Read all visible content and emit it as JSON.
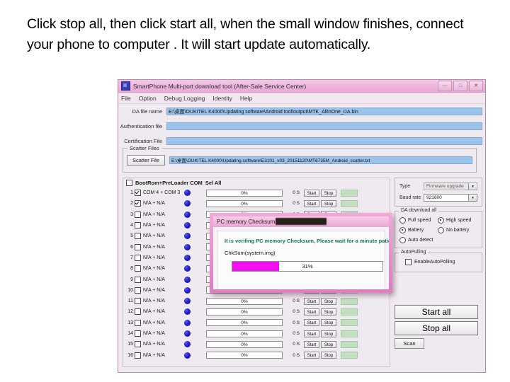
{
  "caption": "Click stop all, then click start all, when the small window finishes, connect your phone to computer . It will start update automatically.",
  "window": {
    "title": "SmartPhone Multi-port download tool (After-Sale Service Center)",
    "icon": "app-icon",
    "controls": {
      "minimize": "—",
      "maximize": "□",
      "close": "✕"
    },
    "menu": [
      "File",
      "Option",
      "Debug Logging",
      "Identity",
      "Help"
    ]
  },
  "files": {
    "da_label": "DA file name",
    "da_value": "E:\\桌面\\OUKITEL K4000\\Updating software\\Android tool\\output\\MTK_AllInOne_DA.bin",
    "auth_label": "Authentication file",
    "auth_value": "",
    "cert_label": "Certification File",
    "cert_value": "",
    "scatter_group": "Scatter Files",
    "scatter_button": "Scatter File",
    "scatter_value": "E:\\桌面\\OUKITEL K4000\\Updating software\\E3101_v03_20151120\\MT6735M_Android_scatter.txt"
  },
  "port_table": {
    "header_checkbox": false,
    "header_label": "BootRom+PreLoader COM",
    "sel_all_label": "Sel All",
    "progress_text": "0%",
    "time_text": "0 S",
    "start_label": "Start",
    "stop_label": "Stop",
    "rows": [
      {
        "num": "1",
        "checked": true,
        "com": "COM 4 + COM 3"
      },
      {
        "num": "2",
        "checked": true,
        "com": "N/A + N/A"
      },
      {
        "num": "3",
        "checked": false,
        "com": "N/A + N/A"
      },
      {
        "num": "4",
        "checked": false,
        "com": "N/A + N/A"
      },
      {
        "num": "5",
        "checked": false,
        "com": "N/A + N/A"
      },
      {
        "num": "6",
        "checked": false,
        "com": "N/A + N/A"
      },
      {
        "num": "7",
        "checked": false,
        "com": "N/A + N/A"
      },
      {
        "num": "8",
        "checked": false,
        "com": "N/A + N/A"
      },
      {
        "num": "9",
        "checked": false,
        "com": "N/A + N/A"
      },
      {
        "num": "10",
        "checked": false,
        "com": "N/A + N/A"
      },
      {
        "num": "11",
        "checked": false,
        "com": "N/A + N/A"
      },
      {
        "num": "12",
        "checked": false,
        "com": "N/A + N/A"
      },
      {
        "num": "13",
        "checked": false,
        "com": "N/A + N/A"
      },
      {
        "num": "14",
        "checked": false,
        "com": "N/A + N/A"
      },
      {
        "num": "15",
        "checked": false,
        "com": "N/A + N/A"
      },
      {
        "num": "16",
        "checked": false,
        "com": "N/A + N/A"
      }
    ]
  },
  "settings": {
    "type_label": "Type",
    "type_value": "Firmware upgrade",
    "baud_label": "Baud rate",
    "baud_value": "921600",
    "da_download_group": "DA download all",
    "full_speed": "Full speed",
    "high_speed": "High speed",
    "full_speed_selected": false,
    "high_speed_selected": true,
    "battery": "Battery",
    "no_battery": "No battery",
    "auto_detect": "Auto detect",
    "battery_selected": true,
    "no_battery_selected": false,
    "auto_detect_selected": false,
    "autopolling_group": "AutoPulling",
    "enable_autopolling": "EnableAutoPolling",
    "enable_autopolling_checked": false
  },
  "actions": {
    "start_all": "Start all",
    "stop_all": "Stop all",
    "scan": "Scan"
  },
  "dialog": {
    "title": "PC memory Checksum",
    "message": "It is verifing PC memory Checksum, Please wait for a minute  patiently.",
    "sub": "ChkSum(system.img)",
    "percent_text": "31%",
    "percent_value": 31,
    "fill_color": "#f20df2",
    "message_color": "#0f7a58"
  }
}
